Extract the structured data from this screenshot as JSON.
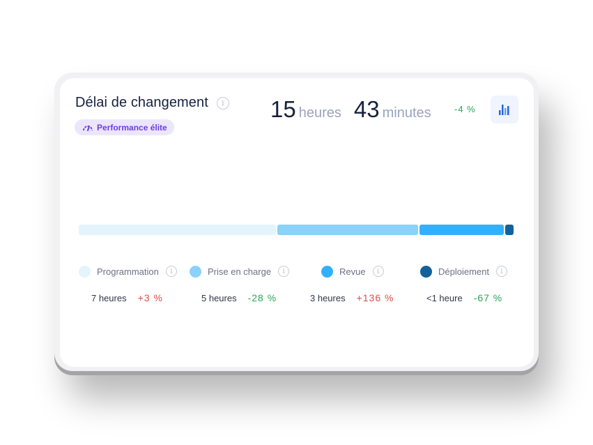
{
  "header": {
    "title": "Délai de changement",
    "badge_label": "Performance élite",
    "hours_value": "15",
    "hours_unit": "heures",
    "minutes_value": "43",
    "minutes_unit": "minutes",
    "delta": "-4 %",
    "chart_button_icon": "bar-chart-icon"
  },
  "colors": {
    "badge_bg": "#ece6fd",
    "badge_text": "#6b3fe0",
    "positive_delta": "#e04a4a",
    "negative_delta": "#2aa55a"
  },
  "chart_data": {
    "type": "bar",
    "orientation": "horizontal-stacked",
    "categories": [
      "Programmation",
      "Prise en charge",
      "Revue",
      "Déploiement"
    ],
    "values": [
      7,
      5,
      3,
      0.3
    ],
    "value_labels": [
      "7 heures",
      "5 heures",
      "3 heures",
      "<1 heure"
    ],
    "deltas": [
      "+3 %",
      "-28 %",
      "+136 %",
      "-67 %"
    ],
    "colors": [
      "#e3f4fd",
      "#8ad1fb",
      "#33b0fb",
      "#13609a"
    ],
    "unit": "heures"
  },
  "legend": [
    {
      "label": "Programmation",
      "value": "7 heures",
      "delta": "+3 %",
      "trend": "up",
      "color": "#e3f4fd"
    },
    {
      "label": "Prise en charge",
      "value": "5 heures",
      "delta": "-28 %",
      "trend": "down",
      "color": "#8ad1fb"
    },
    {
      "label": "Revue",
      "value": "3 heures",
      "delta": "+136 %",
      "trend": "up",
      "color": "#33b0fb"
    },
    {
      "label": "Déploiement",
      "value": "<1 heure",
      "delta": "-67 %",
      "trend": "down",
      "color": "#13609a"
    }
  ]
}
